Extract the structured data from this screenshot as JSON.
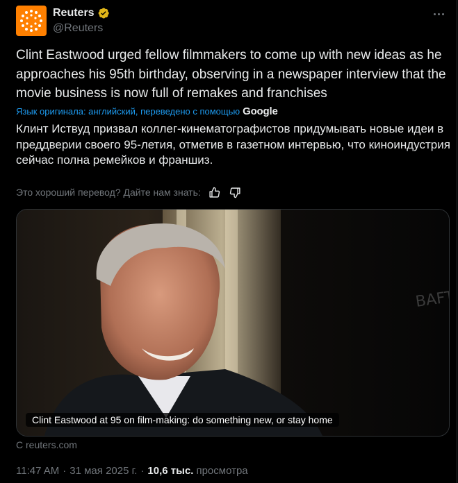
{
  "author": {
    "name": "Reuters",
    "handle": "@Reuters",
    "brand_color": "#ff8000",
    "verified_color": "#e2b719"
  },
  "tweet": {
    "text": "Clint Eastwood urged fellow filmmakers to come up with new ideas as he approaches his 95th birthday, observing in a newspaper interview that the movie business is now full of remakes and franchises",
    "translation_label": "Язык оригинала: английский, переведено с помощью",
    "translation_provider": "Google",
    "translated_text": "Клинт Иствуд призвал коллег-кинематографистов придумывать новые идеи в преддверии своего 95-летия, отметив в газетном интервью, что киноиндустрия сейчас полна ремейков и франшиз.",
    "feedback_prompt": "Это хороший перевод? Дайте нам знать:"
  },
  "card": {
    "title": "Clint Eastwood at 95 on film-making: do something new, or stay home",
    "source": "С reuters.com"
  },
  "meta": {
    "time": "11:47 AM",
    "separator": "·",
    "date": "31 мая 2025 г.",
    "views_count": "10,6 тыс.",
    "views_label": "просмотра"
  },
  "icons": {
    "more": "more-dots-icon",
    "verified": "verified-badge-icon",
    "thumbs_up": "thumbs-up-icon",
    "thumbs_down": "thumbs-down-icon"
  }
}
